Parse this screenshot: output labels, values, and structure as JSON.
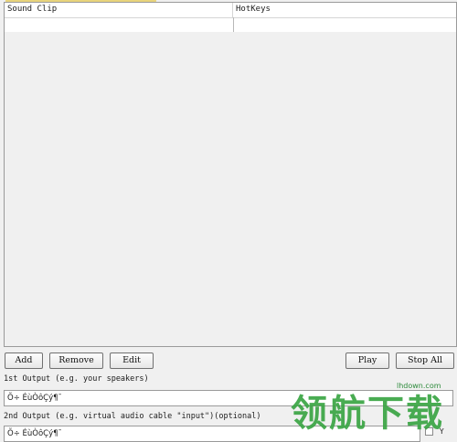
{
  "list": {
    "columns": {
      "sound_clip": "Sound Clip",
      "hotkeys": "HotKeys"
    },
    "rows": [
      {
        "sound_clip": "",
        "hotkeys": ""
      }
    ]
  },
  "buttons": {
    "add": "Add",
    "remove": "Remove",
    "edit": "Edit",
    "play": "Play",
    "stop_all": "Stop All"
  },
  "output1": {
    "label": "1st Output (e.g. your speakers)",
    "value": "Õ÷ ÉùÒôÇý¶¯"
  },
  "output2": {
    "label": "2nd Output (e.g. virtual audio cable \"input\")(optional)",
    "value": "Õ÷ ÉùÒôÇý¶¯"
  },
  "checkbox": {
    "label": "Y",
    "checked": false
  },
  "watermark": {
    "text": "领航下载",
    "url": "lhdown.com"
  }
}
